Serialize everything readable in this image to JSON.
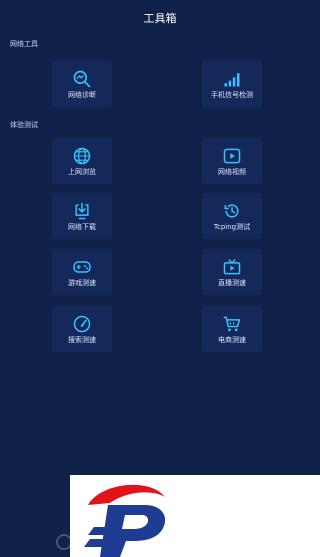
{
  "header": {
    "title": "工具箱"
  },
  "sections": [
    {
      "label": "网络工具",
      "items": [
        {
          "label": "网络诊断",
          "icon": "magnifier-chart-icon"
        },
        {
          "label": "手机信号检测",
          "icon": "signal-bars-icon"
        }
      ]
    },
    {
      "label": "体验测试",
      "items": [
        {
          "label": "上网浏览",
          "icon": "globe-icon"
        },
        {
          "label": "网络视频",
          "icon": "video-play-icon"
        },
        {
          "label": "网络下载",
          "icon": "download-icon"
        },
        {
          "label": "Tcping测试",
          "icon": "history-icon"
        },
        {
          "label": "游戏测速",
          "icon": "gamepad-icon"
        },
        {
          "label": "直播测速",
          "icon": "live-video-icon"
        },
        {
          "label": "搜索测速",
          "icon": "speedometer-icon"
        },
        {
          "label": "电商测速",
          "icon": "shopping-cart-icon"
        }
      ]
    }
  ],
  "colors": {
    "background": "#10214a",
    "tile": "#14295a",
    "icon_accent": "#34c3ff",
    "text": "#dfe7ff"
  }
}
